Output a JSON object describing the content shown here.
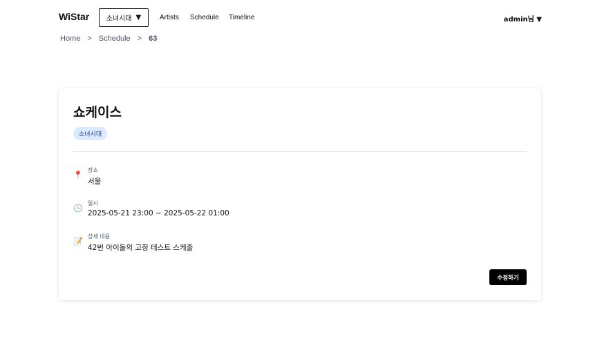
{
  "header": {
    "logo": "WiStar",
    "group_select": {
      "value": "소녀시대",
      "arrow": "▼"
    },
    "nav": [
      {
        "label": "Artists"
      },
      {
        "label": "Schedule"
      },
      {
        "label": "Timeline"
      }
    ],
    "user_menu": "admin님 ▼"
  },
  "breadcrumb": {
    "items": [
      "Home",
      "Schedule"
    ],
    "separator": ">",
    "current": "63"
  },
  "schedule": {
    "title": "쇼케이스",
    "tag": "소녀시대",
    "details": [
      {
        "icon": "pin-icon",
        "glyph": "📍",
        "label": "장소",
        "value": "서울"
      },
      {
        "icon": "clock-icon",
        "glyph": "🕒",
        "label": "일시",
        "value": "2025-05-21 23:00 ~ 2025-05-22 01:00"
      },
      {
        "icon": "memo-icon",
        "glyph": "📝",
        "label": "상세 내용",
        "value": "42번 아이돌의 고정 테스트 스케줄"
      }
    ],
    "edit_button": "수정하기"
  }
}
